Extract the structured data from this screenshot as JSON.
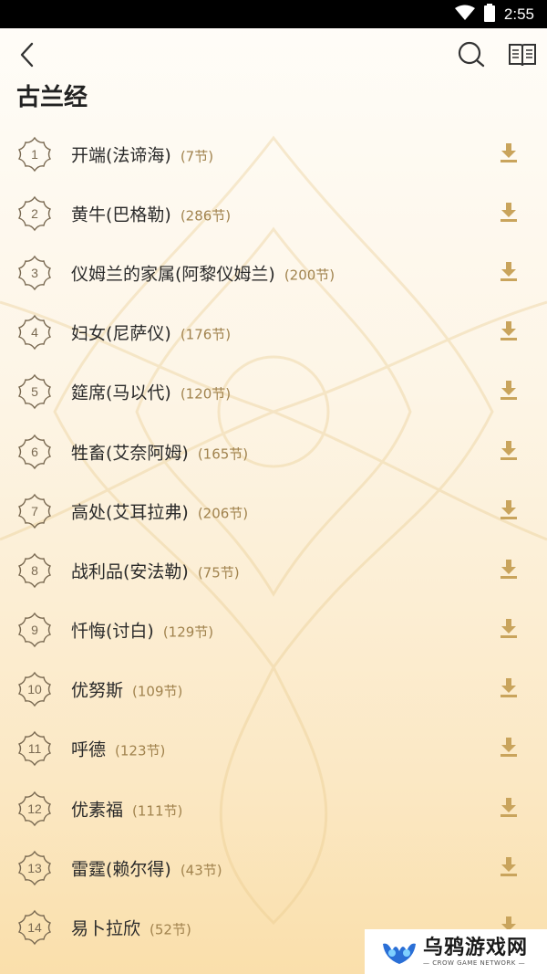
{
  "status_bar": {
    "time": "2:55"
  },
  "header": {
    "title": "古兰经"
  },
  "icons": {
    "back": "back-arrow-icon",
    "search": "search-icon",
    "book": "book-icon",
    "download": "download-icon"
  },
  "colors": {
    "accent": "#c9a45c",
    "count": "#a1834e",
    "title": "#222222"
  },
  "chapters": [
    {
      "number": "1",
      "name": "开端(法谛海)",
      "count": "(7节)"
    },
    {
      "number": "2",
      "name": "黄牛(巴格勒)",
      "count": "(286节)"
    },
    {
      "number": "3",
      "name": "仪姆兰的家属(阿黎仪姆兰)",
      "count": "(200节)"
    },
    {
      "number": "4",
      "name": "妇女(尼萨仪)",
      "count": "(176节)"
    },
    {
      "number": "5",
      "name": "筵席(马以代)",
      "count": "(120节)"
    },
    {
      "number": "6",
      "name": "牲畜(艾奈阿姆)",
      "count": "(165节)"
    },
    {
      "number": "7",
      "name": "高处(艾耳拉弗)",
      "count": "(206节)"
    },
    {
      "number": "8",
      "name": "战利品(安法勒)",
      "count": "(75节)"
    },
    {
      "number": "9",
      "name": "忏悔(讨白)",
      "count": "(129节)"
    },
    {
      "number": "10",
      "name": "优努斯",
      "count": "(109节)"
    },
    {
      "number": "11",
      "name": "呼德",
      "count": "(123节)"
    },
    {
      "number": "12",
      "name": "优素福",
      "count": "(111节)"
    },
    {
      "number": "13",
      "name": "雷霆(赖尔得)",
      "count": "(43节)"
    },
    {
      "number": "14",
      "name": "易卜拉欣",
      "count": "(52节)"
    }
  ],
  "watermark": {
    "cn": "乌鸦游戏网",
    "en": "— CROW GAME NETWORK —"
  }
}
